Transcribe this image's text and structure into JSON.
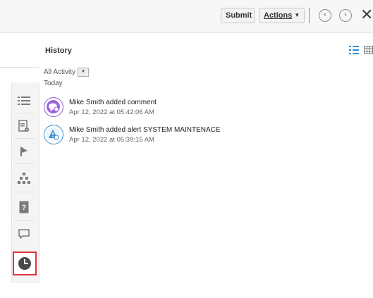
{
  "toolbar": {
    "submit_label": "Submit",
    "actions_label": "Actions",
    "prev_icon": "circle-chevron-left-icon",
    "next_icon": "circle-chevron-right-icon",
    "close_icon": "close-icon"
  },
  "sidebar": {
    "items": [
      {
        "icon": "list-icon",
        "selected": false
      },
      {
        "icon": "document-settings-icon",
        "selected": false
      },
      {
        "icon": "alert-icon",
        "selected": false
      },
      {
        "icon": "hierarchy-icon",
        "selected": false
      },
      {
        "icon": "help-icon",
        "selected": false
      },
      {
        "icon": "comment-icon",
        "selected": false
      },
      {
        "icon": "history-clock-icon",
        "selected": true
      }
    ],
    "highlight_color": "#e0353a"
  },
  "history": {
    "title": "History",
    "filter_label": "All Activity",
    "group_label": "Today",
    "entries": [
      {
        "type": "comment",
        "icon": "comment-avatar-icon",
        "text": "Mike Smith added comment",
        "time": "Apr 12, 2022 at 05:42:06 AM",
        "color": "#9a63dc"
      },
      {
        "type": "alert",
        "icon": "alert-avatar-icon",
        "text": "Mike Smith added alert SYSTEM MAINTENACE",
        "time": "Apr 12, 2022 at 05:39:15 AM",
        "color": "#3a8fd2"
      }
    ]
  },
  "colors": {
    "accent_blue": "#3a8fd2",
    "comment_purple": "#9a63dc",
    "toolbar_bg": "#f7f7f7"
  }
}
